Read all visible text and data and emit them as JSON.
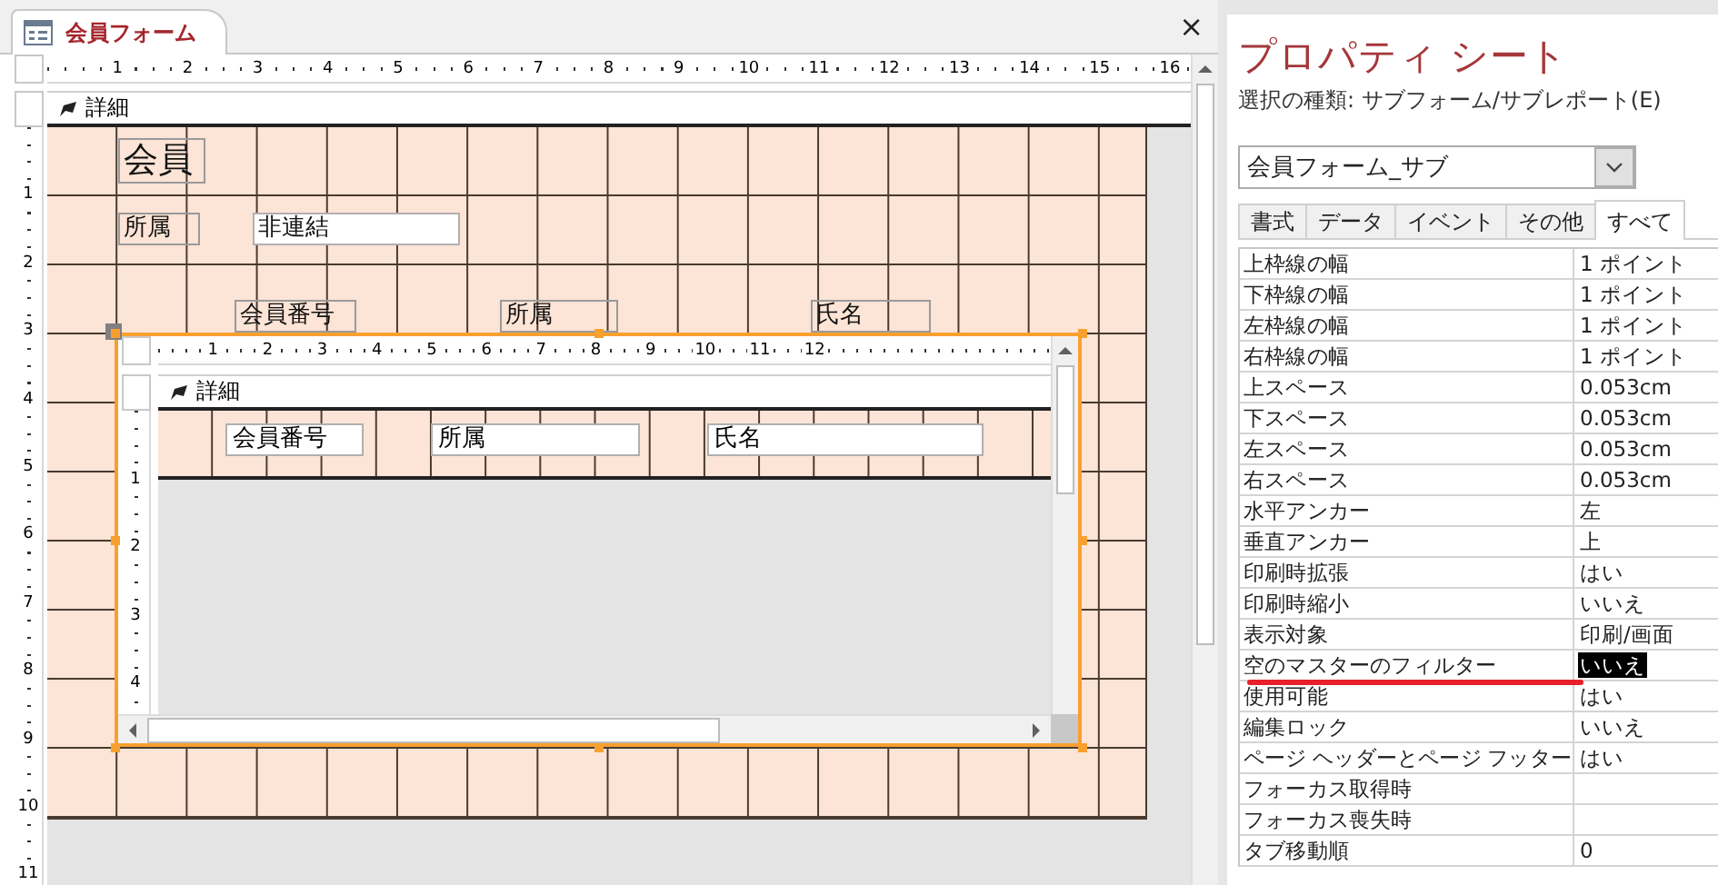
{
  "document_tab": {
    "title": "会員フォーム",
    "close": "×",
    "selected": true
  },
  "form_design": {
    "ruler_h": [
      "1",
      "2",
      "3",
      "4",
      "5",
      "6",
      "7",
      "8",
      "9",
      "10",
      "11",
      "12",
      "13",
      "14",
      "15",
      "16"
    ],
    "ruler_v": [
      "1",
      "2",
      "3",
      "4",
      "5",
      "6",
      "7",
      "8",
      "9",
      "10",
      "11"
    ],
    "section": {
      "label": "詳細"
    },
    "controls": [
      {
        "kind": "label",
        "text": "会員"
      },
      {
        "kind": "label",
        "text": "所属"
      },
      {
        "kind": "textbox",
        "text": "非連結"
      },
      {
        "kind": "label",
        "text": "会員番号"
      },
      {
        "kind": "label",
        "text": "所属"
      },
      {
        "kind": "label",
        "text": "氏名"
      }
    ],
    "subform": {
      "selected": true,
      "ruler_h": [
        "1",
        "2",
        "3",
        "4",
        "5",
        "6",
        "7",
        "8",
        "9",
        "10",
        "11",
        "12"
      ],
      "ruler_v": [
        "1",
        "2",
        "3",
        "4"
      ],
      "section": {
        "label": "詳細"
      },
      "fields": [
        "会員番号",
        "所属",
        "氏名"
      ]
    }
  },
  "property_sheet": {
    "title": "プロパティ シート",
    "selection_type": "選択の種類: サブフォーム/サブレポート(E)",
    "object": "会員フォーム_サブ",
    "tabs": [
      {
        "label": "書式",
        "selected": false
      },
      {
        "label": "データ",
        "selected": false
      },
      {
        "label": "イベント",
        "selected": false
      },
      {
        "label": "その他",
        "selected": false
      },
      {
        "label": "すべて",
        "selected": true
      }
    ],
    "rows": [
      {
        "name": "上枠線の幅",
        "value": "1 ポイント",
        "selected": false,
        "underlined": false
      },
      {
        "name": "下枠線の幅",
        "value": "1 ポイント",
        "selected": false,
        "underlined": false
      },
      {
        "name": "左枠線の幅",
        "value": "1 ポイント",
        "selected": false,
        "underlined": false
      },
      {
        "name": "右枠線の幅",
        "value": "1 ポイント",
        "selected": false,
        "underlined": false
      },
      {
        "name": "上スペース",
        "value": "0.053cm",
        "selected": false,
        "underlined": false
      },
      {
        "name": "下スペース",
        "value": "0.053cm",
        "selected": false,
        "underlined": false
      },
      {
        "name": "左スペース",
        "value": "0.053cm",
        "selected": false,
        "underlined": false
      },
      {
        "name": "右スペース",
        "value": "0.053cm",
        "selected": false,
        "underlined": false
      },
      {
        "name": "水平アンカー",
        "value": "左",
        "selected": false,
        "underlined": false
      },
      {
        "name": "垂直アンカー",
        "value": "上",
        "selected": false,
        "underlined": false
      },
      {
        "name": "印刷時拡張",
        "value": "はい",
        "selected": false,
        "underlined": false
      },
      {
        "name": "印刷時縮小",
        "value": "いいえ",
        "selected": false,
        "underlined": false
      },
      {
        "name": "表示対象",
        "value": "印刷/画面",
        "selected": false,
        "underlined": false
      },
      {
        "name": "空のマスターのフィルター",
        "value": "いいえ",
        "selected": true,
        "underlined": true
      },
      {
        "name": "使用可能",
        "value": "はい",
        "selected": false,
        "underlined": false
      },
      {
        "name": "編集ロック",
        "value": "いいえ",
        "selected": false,
        "underlined": false
      },
      {
        "name": "ページ ヘッダーとページ フッター",
        "value": "はい",
        "selected": false,
        "underlined": false
      },
      {
        "name": "フォーカス取得時",
        "value": "",
        "selected": false,
        "underlined": false
      },
      {
        "name": "フォーカス喪失時",
        "value": "",
        "selected": false,
        "underlined": false
      },
      {
        "name": "タブ移動順",
        "value": "0",
        "selected": false,
        "underlined": false
      }
    ]
  }
}
